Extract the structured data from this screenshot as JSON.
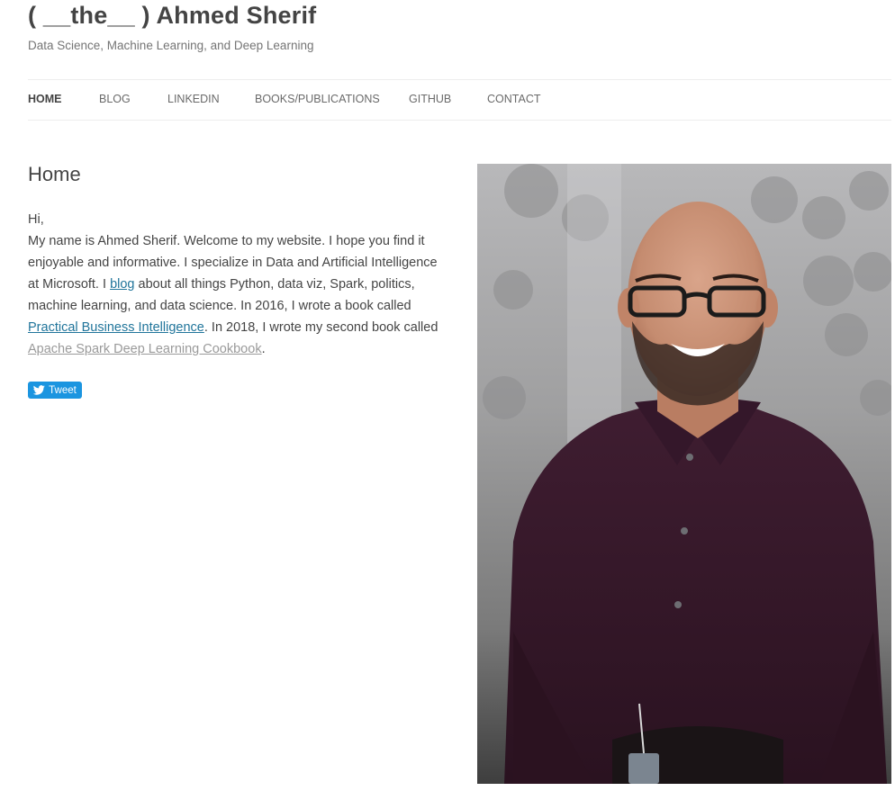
{
  "site": {
    "title": "( __the__ ) Ahmed Sherif",
    "tagline": "Data Science, Machine Learning, and Deep Learning"
  },
  "nav": {
    "items": [
      {
        "label": "HOME",
        "active": true
      },
      {
        "label": "BLOG"
      },
      {
        "label": "LINKEDIN"
      },
      {
        "label": "BOOKS/PUBLICATIONS"
      },
      {
        "label": "GITHUB"
      },
      {
        "label": "CONTACT"
      }
    ]
  },
  "page": {
    "title": "Home",
    "greeting": "Hi,",
    "intro_1": "My name is Ahmed Sherif. Welcome to my website. I hope you find it enjoyable and informative. I specialize in Data and Artificial Intelligence at Microsoft. I ",
    "blog_link": "blog",
    "intro_2": " about all things Python, data viz, Spark, politics, machine learning, and data science.  In 2016, I wrote a book called ",
    "book1_link": "Practical Business Intelligence",
    "intro_3": ".  In 2018, I wrote my second book called ",
    "book2_link": "Apache Spark Deep Learning Cookbook",
    "intro_4": "."
  },
  "tweet": {
    "label": "Tweet",
    "icon": "twitter-bird-icon",
    "color": "#1b95e0"
  },
  "colors": {
    "link": "#21759b",
    "visited_link": "#9a9a9a",
    "shirt": "#3a1a2c"
  }
}
